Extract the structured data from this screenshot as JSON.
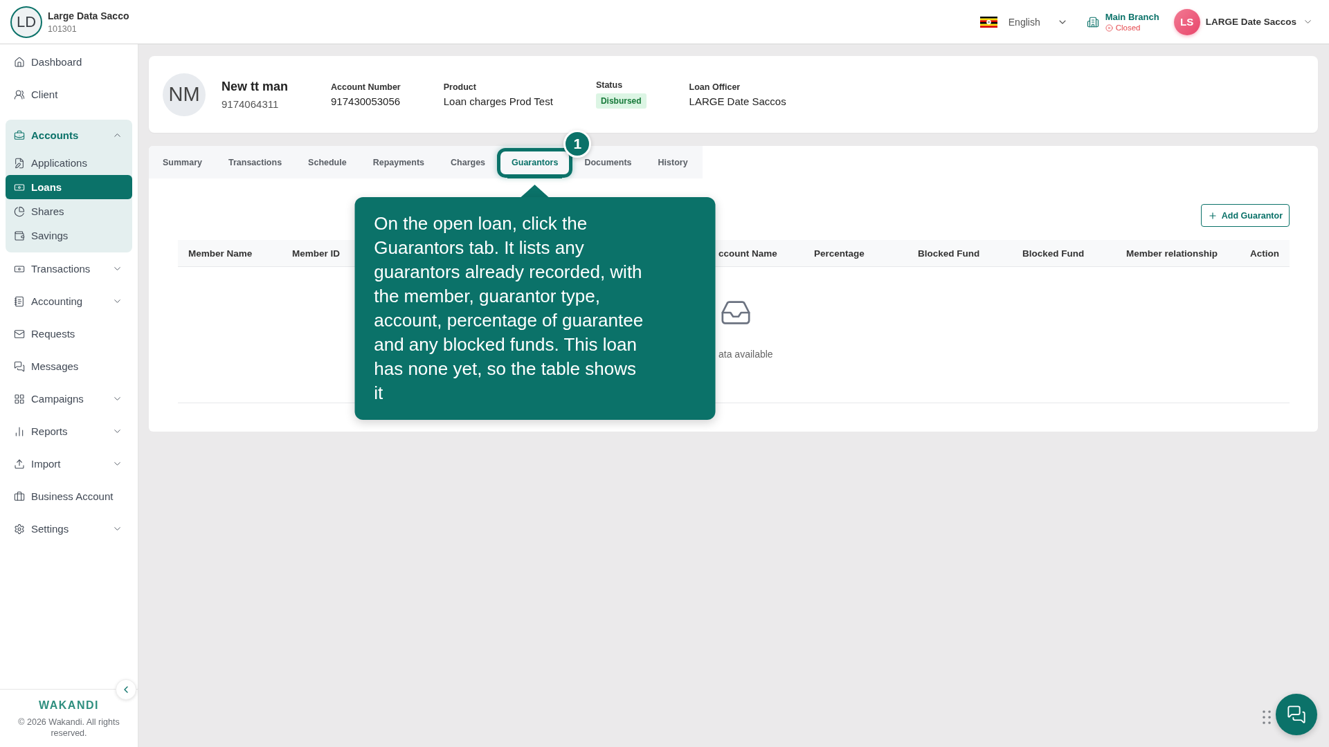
{
  "organization": {
    "initials": "LD",
    "name": "Large Data Sacco",
    "code": "101301"
  },
  "top_bar": {
    "language": "English",
    "branch": {
      "name": "Main Branch",
      "status": "Closed",
      "open": false
    },
    "user": {
      "initials": "LS",
      "name": "LARGE Date Saccos"
    }
  },
  "sidebar": {
    "items": [
      {
        "label": "Dashboard",
        "kind": "link",
        "selected": false
      },
      {
        "label": "Client",
        "kind": "link",
        "selected": false
      },
      {
        "label": "Accounts",
        "kind": "group",
        "selected": true,
        "expanded": true,
        "children": [
          {
            "label": "Applications",
            "selected": false
          },
          {
            "label": "Loans",
            "selected": true
          },
          {
            "label": "Shares",
            "selected": false
          },
          {
            "label": "Savings",
            "selected": false
          }
        ]
      },
      {
        "label": "Transactions",
        "kind": "group",
        "selected": false,
        "expanded": false
      },
      {
        "label": "Accounting",
        "kind": "group",
        "selected": false,
        "expanded": false
      },
      {
        "label": "Requests",
        "kind": "link",
        "selected": false
      },
      {
        "label": "Messages",
        "kind": "link",
        "selected": false
      },
      {
        "label": "Campaigns",
        "kind": "group",
        "selected": false,
        "expanded": false
      },
      {
        "label": "Reports",
        "kind": "group",
        "selected": false,
        "expanded": false
      },
      {
        "label": "Import",
        "kind": "group",
        "selected": false,
        "expanded": false
      },
      {
        "label": "Business Account",
        "kind": "link",
        "selected": false
      },
      {
        "label": "Settings",
        "kind": "group",
        "selected": false,
        "expanded": false
      }
    ],
    "footer": {
      "brand": "WAKANDI",
      "copyright": "© 2026 Wakandi. All rights reserved."
    }
  },
  "loan": {
    "initials": "NM",
    "client_name": "New tt man",
    "client_number": "9174064311",
    "fields": [
      {
        "label": "Account Number",
        "value": "917430053056",
        "kind": "text"
      },
      {
        "label": "Product",
        "value": "Loan charges Prod Test",
        "kind": "text"
      },
      {
        "label": "Status",
        "value": "Disbursed",
        "kind": "badge"
      },
      {
        "label": "Loan Officer",
        "value": "LARGE Date Saccos",
        "kind": "text"
      }
    ]
  },
  "tabs": [
    {
      "label": "Summary",
      "selected": false
    },
    {
      "label": "Transactions",
      "selected": false
    },
    {
      "label": "Schedule",
      "selected": false
    },
    {
      "label": "Repayments",
      "selected": false
    },
    {
      "label": "Charges",
      "selected": false
    },
    {
      "label": "Guarantors",
      "selected": true
    },
    {
      "label": "Documents",
      "selected": false
    },
    {
      "label": "History",
      "selected": false
    }
  ],
  "tutorial": {
    "step": "1",
    "text": "On the open loan, click the Guarantors tab. It lists any guarantors already recorded, with the member, guarantor type, account, percentage of guarantee and any blocked funds. This loan has none yet, so the table shows it"
  },
  "guarantors": {
    "add_button": "Add Guarantor",
    "columns": [
      "Member Name",
      "Member ID",
      "ccount Name",
      "Percentage",
      "Blocked Fund",
      "Blocked Fund",
      "Member relationship",
      "Action"
    ],
    "empty_text": "ata available"
  }
}
